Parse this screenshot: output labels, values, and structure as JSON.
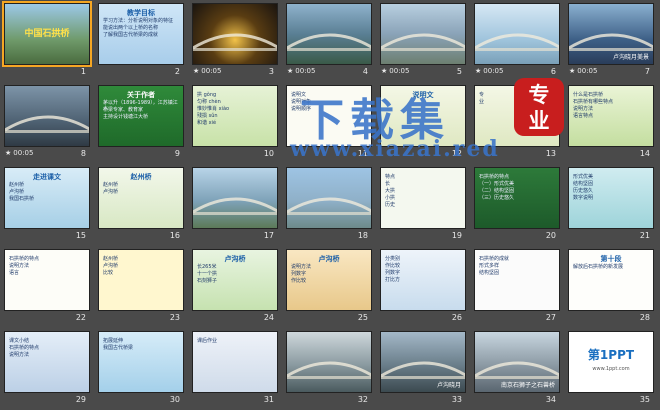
{
  "slides": [
    {
      "num": "1",
      "title": "中国石拱桥",
      "kind": "bridge-title",
      "selected": true
    },
    {
      "num": "2",
      "title": "教学目标",
      "lines": [
        "学习方法：分析说明对象的特征",
        "能说出两个以上桥的名称",
        "了解我国古代桥梁的成就"
      ],
      "kind": "text-blue"
    },
    {
      "num": "3",
      "time": "00:05",
      "kind": "photo-night"
    },
    {
      "num": "4",
      "time": "00:05",
      "kind": "photo-river"
    },
    {
      "num": "5",
      "time": "00:05",
      "kind": "photo-city"
    },
    {
      "num": "6",
      "time": "00:05",
      "kind": "photo-sea"
    },
    {
      "num": "7",
      "caption": "卢沟晓月美景",
      "time": "00:05",
      "kind": "photo-arch"
    },
    {
      "num": "8",
      "time": "00:05",
      "kind": "photo-bridge2"
    },
    {
      "num": "9",
      "title": "关于作者",
      "lines": [
        "茅以升（1896-1989），江苏镇江人",
        "桥梁专家、教育家",
        "主持设计钱塘江大桥"
      ],
      "kind": "text-green"
    },
    {
      "num": "10",
      "lines": [
        "拱 gǒng",
        "匀称 chèn",
        "惟妙惟肖 xiào",
        "残损 sǔn",
        "和谐 xié"
      ],
      "kind": "text-leaf"
    },
    {
      "num": "11",
      "lines": [
        "说明文",
        "说明对象",
        "说明顺序"
      ],
      "kind": "text-white"
    },
    {
      "num": "12",
      "title": "说明文",
      "kind": "text-bamboo"
    },
    {
      "num": "13",
      "lines": [
        "专",
        "业"
      ],
      "kind": "text-bamboo2"
    },
    {
      "num": "14",
      "lines": [
        "什么是石拱桥",
        "石拱桥有哪些特点",
        "说明方法",
        "语言特点"
      ],
      "kind": "text-bamboo3"
    },
    {
      "num": "15",
      "title": "走进课文",
      "lines": [
        "赵州桥",
        "卢沟桥",
        "我国石拱桥"
      ],
      "kind": "text-dandelion"
    },
    {
      "num": "16",
      "title": "赵州桥",
      "lines": [
        "赵州桥",
        "卢沟桥"
      ],
      "kind": "text-flower"
    },
    {
      "num": "17",
      "kind": "photo-zhaozhou"
    },
    {
      "num": "18",
      "kind": "photo-lugou"
    },
    {
      "num": "19",
      "lines": [
        "特点",
        "长",
        "大拱",
        "小拱",
        "历史"
      ],
      "kind": "table-green"
    },
    {
      "num": "20",
      "lines": [
        "石拱桥的特点",
        "（一）形式优美",
        "（二）结构坚固",
        "（三）历史悠久"
      ],
      "kind": "text-bamboo4"
    },
    {
      "num": "21",
      "lines": [
        "形式优美",
        "结构坚固",
        "历史悠久",
        "数字说明"
      ],
      "kind": "text-cyan"
    },
    {
      "num": "22",
      "lines": [
        "石拱桥的特点",
        "说明方法",
        "语言"
      ],
      "kind": "text-white2"
    },
    {
      "num": "23",
      "lines": [
        "赵州桥",
        "卢沟桥",
        "比较"
      ],
      "kind": "table-yellow"
    },
    {
      "num": "24",
      "title": "卢沟桥",
      "lines": [
        "长265米",
        "十一个拱",
        "石刻狮子"
      ],
      "kind": "text-green2"
    },
    {
      "num": "25",
      "title": "卢沟桥",
      "lines": [
        "说明方法",
        "列数字",
        "作比较"
      ],
      "kind": "text-orange"
    },
    {
      "num": "26",
      "lines": [
        "分类别",
        "作比较",
        "列数字",
        "打比方"
      ],
      "kind": "text-dandelion2"
    },
    {
      "num": "27",
      "lines": [
        "石拱桥的成就",
        "形式多样",
        "结构坚固"
      ],
      "kind": "text-white3"
    },
    {
      "num": "28",
      "title": "第十段",
      "lines": [
        "解放后石拱桥的新发展"
      ],
      "kind": "text-white4"
    },
    {
      "num": "29",
      "lines": [
        "课文小结",
        "石拱桥的特点",
        "说明方法"
      ],
      "kind": "text-frame"
    },
    {
      "num": "30",
      "lines": [
        "拓展延伸",
        "我国古代桥梁"
      ],
      "kind": "text-butterfly"
    },
    {
      "num": "31",
      "lines": [
        "课后作业"
      ],
      "kind": "text-flower2"
    },
    {
      "num": "32",
      "kind": "photo-stone"
    },
    {
      "num": "33",
      "caption": "卢沟晓月",
      "kind": "photo-gate"
    },
    {
      "num": "34",
      "caption": "南京石狮子之石兽桥",
      "kind": "photo-lions"
    },
    {
      "num": "35",
      "title": "第1PPT",
      "lines": [
        "www.1ppt.com"
      ],
      "kind": "logo"
    }
  ],
  "watermark": {
    "big": "下载集",
    "url": "www.xiazai.red",
    "badge_a": "专",
    "badge_b": "业"
  }
}
